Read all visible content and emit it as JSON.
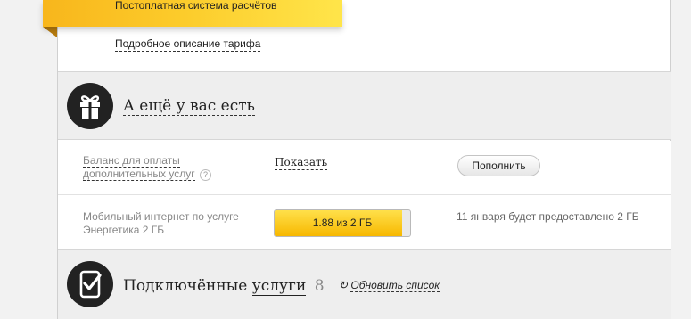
{
  "tariff": {
    "billing": "Постоплатная система расчётов",
    "details_link": "Подробное описание тарифа"
  },
  "extras": {
    "icon": "gift-icon",
    "title": "А ещё у вас есть",
    "balance_label_line1": "Баланс для оплаты",
    "balance_label_line2": "дополнительных услуг",
    "help_glyph": "?",
    "show_link": "Показать",
    "topup_button": "Пополнить",
    "internet_label_line1": "Мобильный интернет по услуге",
    "internet_label_line2": "Энергетика 2 ГБ",
    "internet_usage": "1.88 из 2 ГБ",
    "internet_used_fraction": 0.94,
    "internet_note": "11 января будет предоставлено 2 ГБ"
  },
  "services": {
    "icon": "phone-check-icon",
    "title_prefix": "Подключённые",
    "title_link": "услуги",
    "count": "8",
    "refresh_glyph": "↻",
    "refresh_link": "Обновить список"
  },
  "colors": {
    "accent_yellow": "#fccb2a",
    "icon_circle": "#222222"
  }
}
